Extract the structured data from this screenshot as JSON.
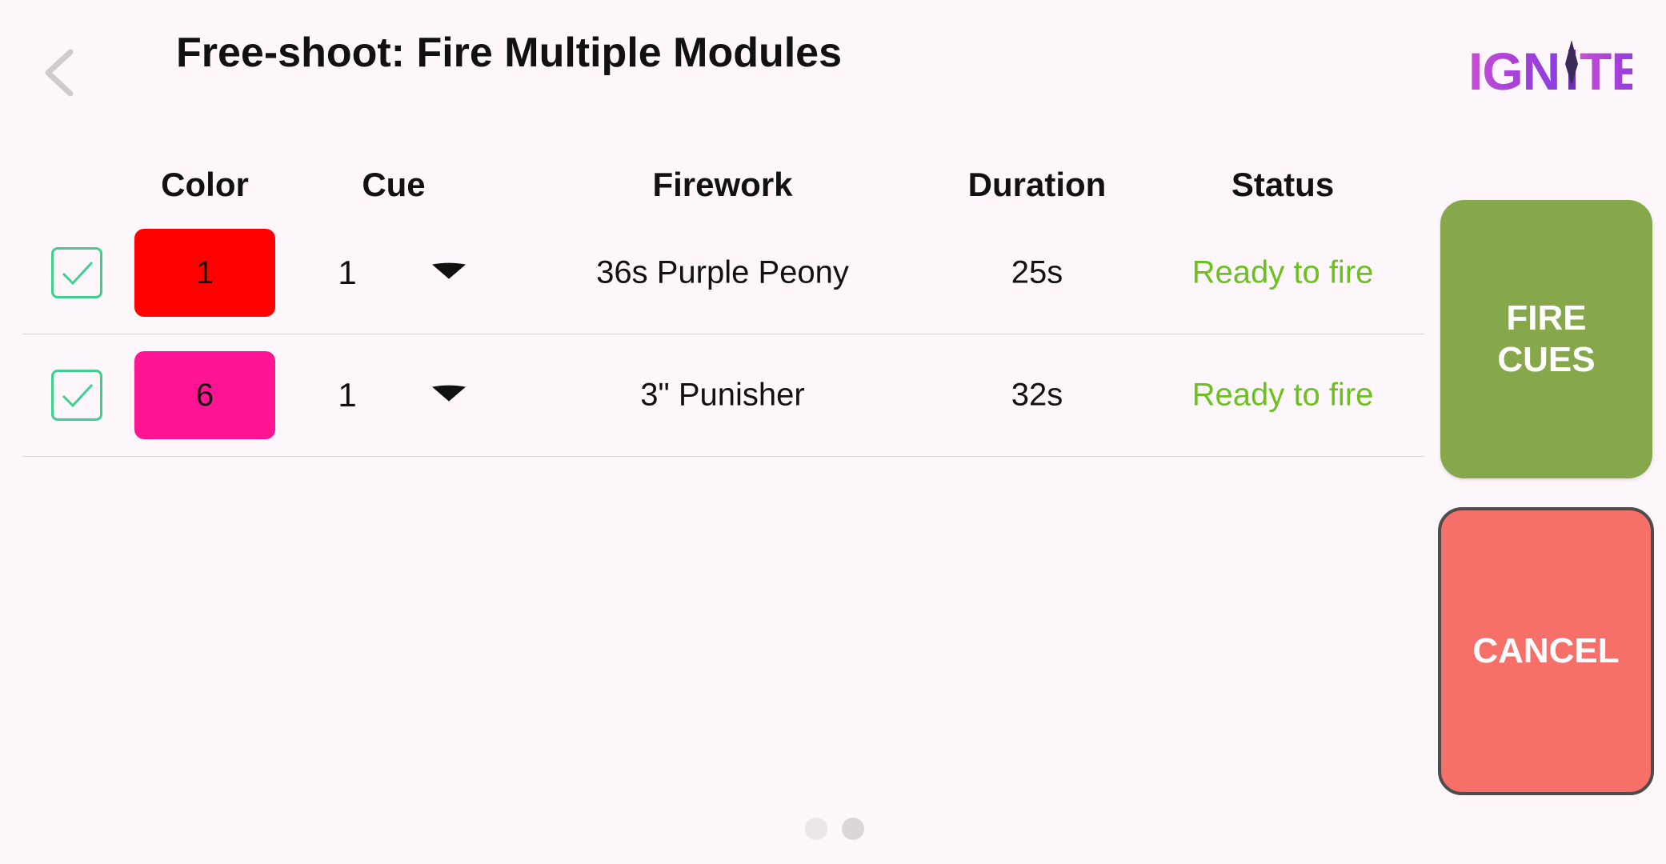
{
  "header": {
    "title": "Free-shoot: Fire Multiple Modules",
    "back_icon": "chevron-left-icon",
    "logo_text": "IGNITE"
  },
  "table": {
    "columns": {
      "color": "Color",
      "cue": "Cue",
      "firework": "Firework",
      "duration": "Duration",
      "status": "Status"
    },
    "rows": [
      {
        "checked": true,
        "module": "1",
        "module_color": "#ff0000",
        "cue": "1",
        "firework": "36s Purple Peony",
        "duration": "25s",
        "status": "Ready to fire"
      },
      {
        "checked": true,
        "module": "6",
        "module_color": "#ff1493",
        "cue": "1",
        "firework": "3\" Punisher",
        "duration": "32s",
        "status": "Ready to fire"
      }
    ]
  },
  "actions": {
    "fire_label_line1": "FIRE",
    "fire_label_line2": "CUES",
    "cancel_label": "CANCEL",
    "fire_color": "#86a84a",
    "cancel_color": "#f76f69"
  },
  "pager": {
    "pages": 2,
    "current": 2
  },
  "colors": {
    "status_ready": "#6cc020",
    "checkbox": "#3fcf8e"
  }
}
